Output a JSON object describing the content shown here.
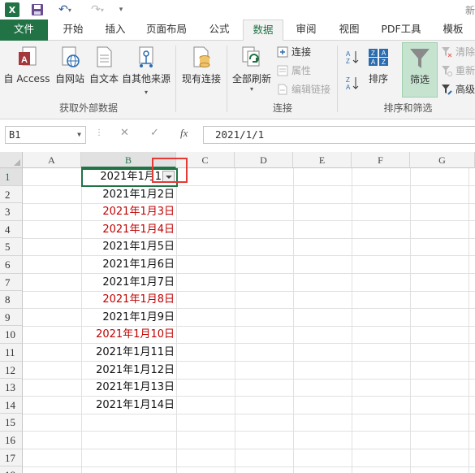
{
  "qat": {
    "title": "新"
  },
  "tabs": [
    {
      "label": "文件"
    },
    {
      "label": "开始"
    },
    {
      "label": "插入"
    },
    {
      "label": "页面布局"
    },
    {
      "label": "公式"
    },
    {
      "label": "数据"
    },
    {
      "label": "审阅"
    },
    {
      "label": "视图"
    },
    {
      "label": "PDF工具"
    },
    {
      "label": "模板"
    }
  ],
  "ribbon": {
    "get_external": {
      "access": "自 Access",
      "web": "自网站",
      "text": "自文本",
      "other": "自其他来源",
      "group_label": "获取外部数据"
    },
    "existing_conn": "现有连接",
    "connections": {
      "refresh_all": "全部刷新",
      "connections": "连接",
      "properties": "属性",
      "edit_links": "编辑链接",
      "group_label": "连接"
    },
    "sort_filter": {
      "sort": "排序",
      "filter": "筛选",
      "clear": "清除",
      "reapply": "重新",
      "advanced": "高级",
      "group_label": "排序和筛选"
    }
  },
  "formula_bar": {
    "name_box": "B1",
    "fx": "fx",
    "value": "2021/1/1"
  },
  "columns": [
    "A",
    "B",
    "C",
    "D",
    "E",
    "F",
    "G"
  ],
  "rows": [
    "1",
    "2",
    "3",
    "4",
    "5",
    "6",
    "7",
    "8",
    "9",
    "10",
    "11",
    "12",
    "13",
    "14",
    "15",
    "16",
    "17",
    "18"
  ],
  "cells_b": [
    {
      "text": "2021年1月1",
      "red": false
    },
    {
      "text": "2021年1月2日",
      "red": false
    },
    {
      "text": "2021年1月3日",
      "red": true
    },
    {
      "text": "2021年1月4日",
      "red": true
    },
    {
      "text": "2021年1月5日",
      "red": false
    },
    {
      "text": "2021年1月6日",
      "red": false
    },
    {
      "text": "2021年1月7日",
      "red": false
    },
    {
      "text": "2021年1月8日",
      "red": true
    },
    {
      "text": "2021年1月9日",
      "red": false
    },
    {
      "text": "2021年1月10日",
      "red": true
    },
    {
      "text": "2021年1月11日",
      "red": false
    },
    {
      "text": "2021年1月12日",
      "red": false
    },
    {
      "text": "2021年1月13日",
      "red": false
    },
    {
      "text": "2021年1月14日",
      "red": false
    }
  ],
  "colors": {
    "excel_green": "#217346",
    "red_text": "#c00000",
    "highlight_box": "#e53935"
  }
}
